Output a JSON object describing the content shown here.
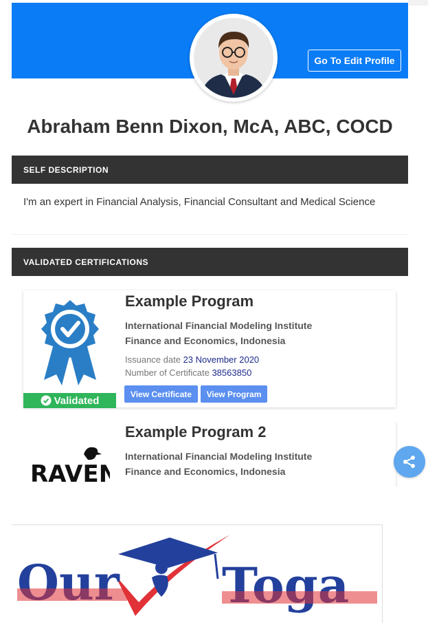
{
  "profile": {
    "name": "Abraham Benn Dixon, McA, ABC, COCD",
    "edit_label": "Go To Edit Profile"
  },
  "sections": {
    "self_description": "SELF DESCRIPTION",
    "validated_certifications": "VALIDATED CERTIFICATIONS"
  },
  "description": "I'm an expert in Financial Analysis, Financial Consultant and Medical Science",
  "certificates": [
    {
      "title": "Example Program",
      "institute": "International Financial Modeling Institute",
      "field": "Finance and Economics, Indonesia",
      "issuance_label": "Issuance date",
      "issuance_date": "23 November 2020",
      "number_label": "Number of Certificate",
      "number": "38563850",
      "validated_label": "Validated",
      "view_certificate_label": "View Certificate",
      "view_program_label": "View Program"
    },
    {
      "title": "Example Program 2",
      "institute": "International Financial Modeling Institute",
      "field": "Finance and Economics, Indonesia",
      "logo_text": "RAVEN"
    }
  ],
  "brand": {
    "word1": "Our",
    "word2": "Toga"
  },
  "colors": {
    "banner": "#0a7cf6",
    "section_bar": "#333333",
    "validated": "#2fb55a",
    "button": "#5b8ff0",
    "share": "#5fa7ee",
    "brand_blue": "#23409c",
    "brand_red": "#e03237"
  },
  "icons": {
    "avatar": "avatar",
    "badge": "award-ribbon-icon",
    "check": "check-circle-icon",
    "share": "share-icon",
    "raven": "raven-logo"
  }
}
